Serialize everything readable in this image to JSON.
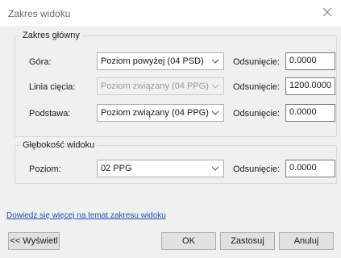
{
  "window": {
    "title": "Zakres widoku"
  },
  "primary_range": {
    "legend": "Zakres główny",
    "rows": [
      {
        "label": "Góra:",
        "level": "Poziom powyżej (04 PSD)",
        "offset_label": "Odsunięcie:",
        "offset": "0.0000",
        "disabled": false
      },
      {
        "label": "Linia cięcia:",
        "level": "Poziom związany (04 PPG)",
        "offset_label": "Odsunięcie:",
        "offset": "1200.0000",
        "disabled": true
      },
      {
        "label": "Podstawa:",
        "level": "Poziom związany (04 PPG)",
        "offset_label": "Odsunięcie:",
        "offset": "0.0000",
        "disabled": false
      }
    ]
  },
  "view_depth": {
    "legend": "Głębokość widoku",
    "label": "Poziom:",
    "level": "02 PPG",
    "offset_label": "Odsunięcie:",
    "offset": "0.0000"
  },
  "help_link": "Dowiedz się więcej na temat zakresu widoku",
  "buttons": {
    "show": "<< Wyświetl",
    "ok": "OK",
    "apply": "Zastosuj",
    "cancel": "Anuluj"
  },
  "colors": {
    "link": "#1f4fb3",
    "panel": "#f0f0f0"
  }
}
